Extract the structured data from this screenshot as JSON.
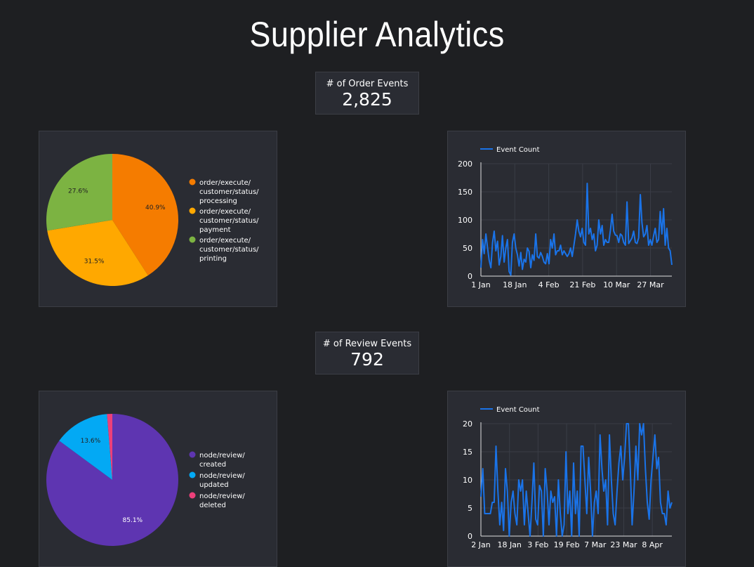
{
  "page": {
    "title": "Supplier Analytics"
  },
  "order_kpi": {
    "label": "# of Order Events",
    "value": "2,825"
  },
  "review_kpi": {
    "label": "# of Review Events",
    "value": "792"
  },
  "chart_data": [
    {
      "id": "order-pie",
      "type": "pie",
      "slices": [
        {
          "name": "order/execute/customer/status/processing",
          "lines": [
            "order/execute/",
            "customer/status/",
            "processing"
          ],
          "value": 40.9,
          "label": "40.9%",
          "color": "#f57c00"
        },
        {
          "name": "order/execute/customer/status/payment",
          "lines": [
            "order/execute/",
            "customer/status/",
            "payment"
          ],
          "value": 31.5,
          "label": "31.5%",
          "color": "#ffa800"
        },
        {
          "name": "order/execute/customer/status/printing",
          "lines": [
            "order/execute/",
            "customer/status/",
            "printing"
          ],
          "value": 27.6,
          "label": "27.6%",
          "color": "#7cb342"
        }
      ]
    },
    {
      "id": "order-line",
      "type": "line",
      "series": [
        {
          "name": "Event Count",
          "color": "#1a73e8",
          "values": [
            15,
            65,
            40,
            75,
            50,
            28,
            15,
            60,
            80,
            45,
            62,
            20,
            35,
            72,
            25,
            50,
            65,
            8,
            2,
            60,
            75,
            50,
            38,
            18,
            42,
            12,
            30,
            25,
            50,
            44,
            15,
            38,
            28,
            75,
            35,
            32,
            42,
            35,
            25,
            22,
            40,
            22,
            65,
            50,
            75,
            38,
            45,
            45,
            55,
            38,
            45,
            40,
            35,
            40,
            50,
            35,
            55,
            75,
            100,
            80,
            70,
            85,
            60,
            55,
            165,
            75,
            85,
            65,
            75,
            45,
            55,
            100,
            75,
            90,
            55,
            65,
            60,
            60,
            82,
            110,
            80,
            73,
            72,
            60,
            75,
            72,
            60,
            55,
            132,
            58,
            63,
            68,
            80,
            60,
            58,
            68,
            145,
            95,
            70,
            75,
            90,
            55,
            65,
            55,
            72,
            85,
            60,
            65,
            115,
            75,
            120,
            55,
            85,
            50,
            45,
            20
          ]
        }
      ],
      "x_ticks": [
        "1 Jan",
        "18 Jan",
        "4 Feb",
        "21 Feb",
        "10 Mar",
        "27 Mar"
      ],
      "y_ticks": [
        "0",
        "50",
        "100",
        "150",
        "200"
      ],
      "ylim": [
        0,
        200
      ]
    },
    {
      "id": "review-pie",
      "type": "pie",
      "slices": [
        {
          "name": "node/review/created",
          "lines": [
            "node/review/",
            "created"
          ],
          "value": 85.1,
          "label": "85.1%",
          "color": "#5e35b1"
        },
        {
          "name": "node/review/updated",
          "lines": [
            "node/review/",
            "updated"
          ],
          "value": 13.6,
          "label": "13.6%",
          "color": "#03a9f4"
        },
        {
          "name": "node/review/deleted",
          "lines": [
            "node/review/",
            "deleted"
          ],
          "value": 1.3,
          "label": "",
          "color": "#ec407a"
        }
      ]
    },
    {
      "id": "review-line",
      "type": "line",
      "series": [
        {
          "name": "Event Count",
          "color": "#1a73e8",
          "values": [
            7,
            12,
            4,
            4,
            4,
            4,
            6,
            6,
            16,
            8,
            2,
            6,
            1,
            12,
            8,
            0,
            6,
            8,
            4,
            2,
            10,
            8,
            10,
            2,
            8,
            4,
            0,
            6,
            13,
            3,
            2,
            9,
            8,
            0,
            12,
            8,
            2,
            8,
            6,
            7,
            0,
            10,
            4,
            0,
            2,
            15,
            4,
            8,
            0,
            13,
            4,
            8,
            0,
            16,
            16,
            10,
            4,
            14,
            8,
            0,
            6,
            8,
            4,
            18,
            12,
            8,
            10,
            2,
            18,
            10,
            4,
            2,
            8,
            13,
            16,
            10,
            14,
            20,
            20,
            12,
            2,
            8,
            16,
            10,
            20,
            18,
            20,
            12,
            6,
            3,
            10,
            14,
            18,
            12,
            14,
            6,
            4,
            4,
            2,
            8,
            5,
            6
          ]
        }
      ],
      "x_ticks": [
        "2 Jan",
        "18 Jan",
        "3 Feb",
        "19 Feb",
        "7 Mar",
        "23 Mar",
        "8 Apr"
      ],
      "y_ticks": [
        "0",
        "5",
        "10",
        "15",
        "20"
      ],
      "ylim": [
        0,
        20
      ]
    }
  ]
}
